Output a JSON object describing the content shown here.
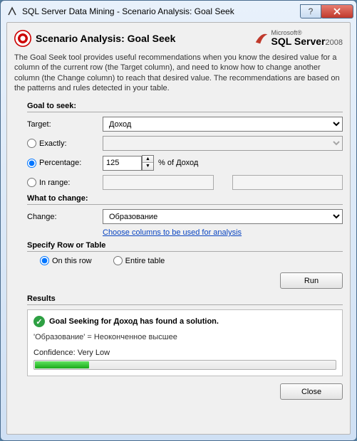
{
  "titlebar": {
    "title": "SQL Server Data Mining - Scenario Analysis: Goal Seek"
  },
  "header": {
    "title": "Scenario Analysis: Goal Seek",
    "brand_top": "Microsoft®",
    "brand_main": "SQL Server",
    "brand_year": "2008"
  },
  "description": "The Goal Seek tool provides useful recommendations when you know the desired value for a column of the current row (the Target column), and need to know how to change another column (the Change column) to reach that desired value. The recommendations are based on the patterns and rules detected in your table.",
  "goal": {
    "section": "Goal to seek:",
    "target_label": "Target:",
    "target_value": "Доход",
    "exactly_label": "Exactly:",
    "percentage_label": "Percentage:",
    "percentage_value": "125",
    "percentage_suffix": "% of Доход",
    "inrange_label": "In range:",
    "selected_mode": "percentage"
  },
  "change": {
    "section": "What to change:",
    "label": "Change:",
    "value": "Образование",
    "link": "Choose columns to be used for analysis"
  },
  "scope": {
    "section": "Specify Row or Table",
    "thisrow": "On this row",
    "entire": "Entire table",
    "selected": "thisrow"
  },
  "buttons": {
    "run": "Run",
    "close": "Close"
  },
  "results": {
    "section": "Results",
    "summary": "Goal Seeking for Доход has found a solution.",
    "detail": "'Образование' = Неоконченное высшее",
    "confidence_label": "Confidence: Very Low",
    "confidence_pct": 18
  }
}
